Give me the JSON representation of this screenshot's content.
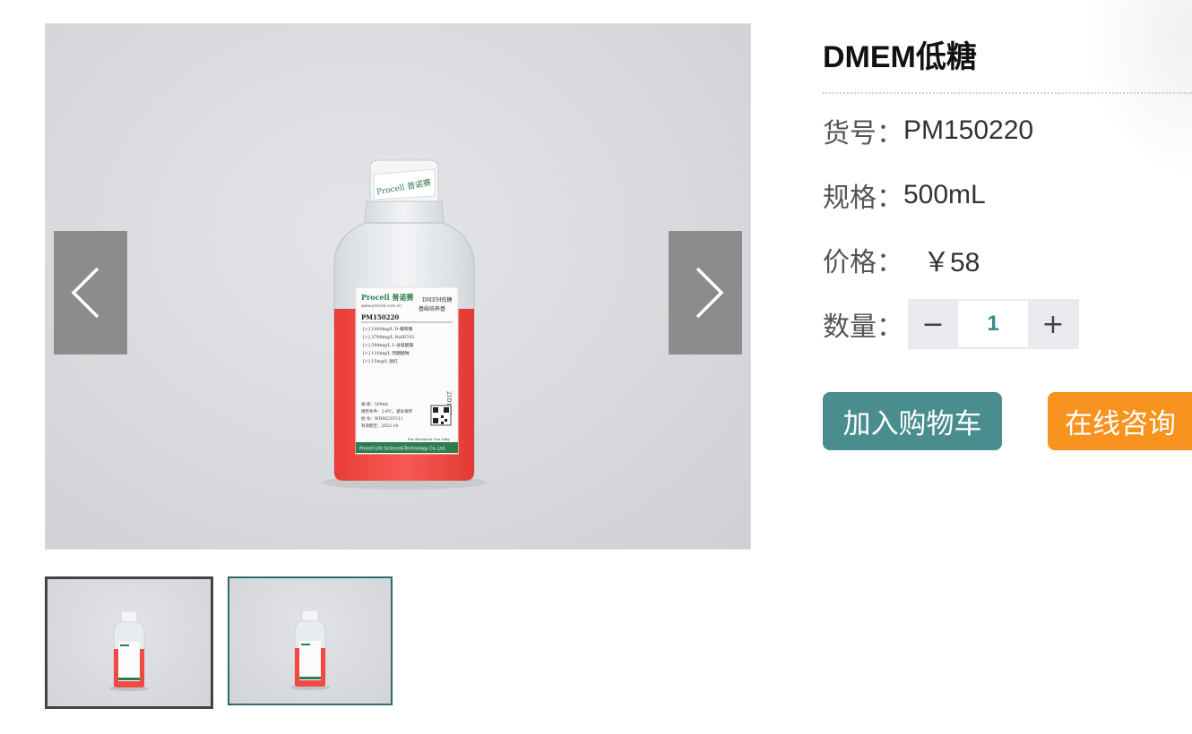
{
  "product": {
    "title": "DMEM低糖",
    "sku_label": "货号：",
    "sku": "PM150220",
    "spec_label": "规格：",
    "spec": "500mL",
    "price_label": "价格：",
    "price": "￥58",
    "qty_label": "数量：",
    "qty": "1"
  },
  "stepper": {
    "minus": "−",
    "plus": "+"
  },
  "actions": {
    "add_to_cart": "加入购物车",
    "consult": "在线咨询"
  },
  "bottle_label": {
    "brand": "Procell 普诺赛",
    "url": "www.procell.com.cn",
    "name_line1": "DMEM低糖",
    "name_line2": "基础培养基",
    "catalog": "PM150220",
    "items": [
      "[+] 1000mg/L D-葡萄糖",
      "[+] 3700mg/L NaHCO3",
      "[+] 584mg/L L-谷氨酰胺",
      "[+] 110mg/L 丙酮酸钠",
      "[+] 15mg/L 酚红"
    ],
    "lot": "21D1169",
    "spec_line": "规    格：500mL",
    "storage_line": "储存条件：2-8℃，避光保存",
    "batch_line": "批    号：WH0621F211",
    "expiry_line": "有效期至：2022-10",
    "ruo": "For Research Use Only",
    "company": "Procell Life Science&Technology Co.,Ltd."
  },
  "colors": {
    "teal": "#4a8d8f",
    "orange": "#f7931e",
    "medium_red": "#f0443f",
    "brand_green": "#2e7d4f"
  },
  "icons": {
    "prev": "chevron-left-icon",
    "next": "chevron-right-icon"
  }
}
